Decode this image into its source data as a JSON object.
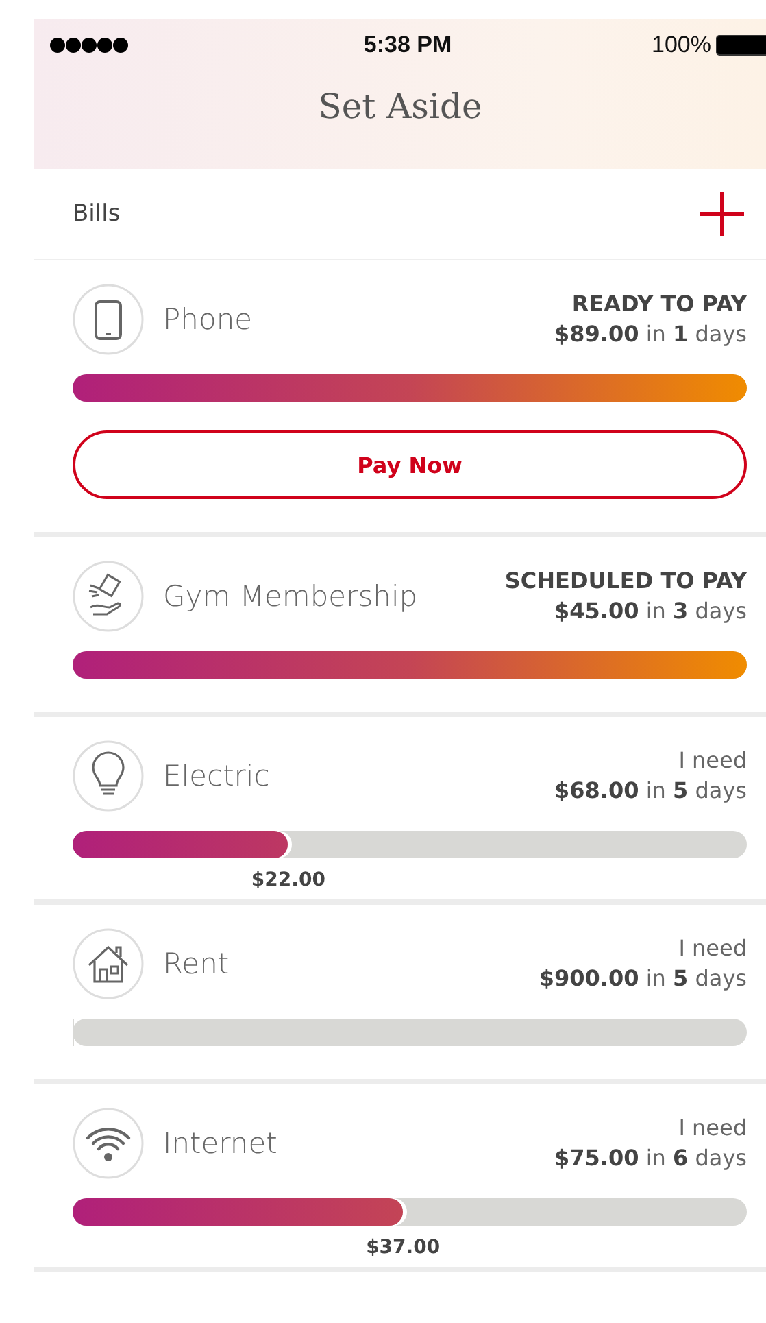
{
  "status_bar": {
    "time": "5:38 PM",
    "battery": "100%"
  },
  "header": {
    "title": "Set Aside"
  },
  "section": {
    "title": "Bills"
  },
  "bills": [
    {
      "name": "Phone",
      "status": "READY TO PAY",
      "kind": "bold",
      "due": "**$89.00** in **1** days",
      "level": 1,
      "action": "Pay Now"
    },
    {
      "name": "Gym Membership",
      "status": "SCHEDULED TO PAY",
      "kind": "bold",
      "due": "**$45.00** in **3** days",
      "level": 1
    },
    {
      "name": "Electric",
      "status": "I need",
      "kind": "light",
      "due": "**$68.00** in **5** days",
      "level": 0.32,
      "saved": "$22.00"
    },
    {
      "name": "Rent",
      "status": "I need",
      "kind": "light",
      "due": "**$900.00** in **5** days",
      "level": 0
    },
    {
      "name": "Internet",
      "status": "I need",
      "kind": "light",
      "due": "**$75.00** in **6** days",
      "level": 0.49,
      "saved": "$37.00"
    }
  ]
}
